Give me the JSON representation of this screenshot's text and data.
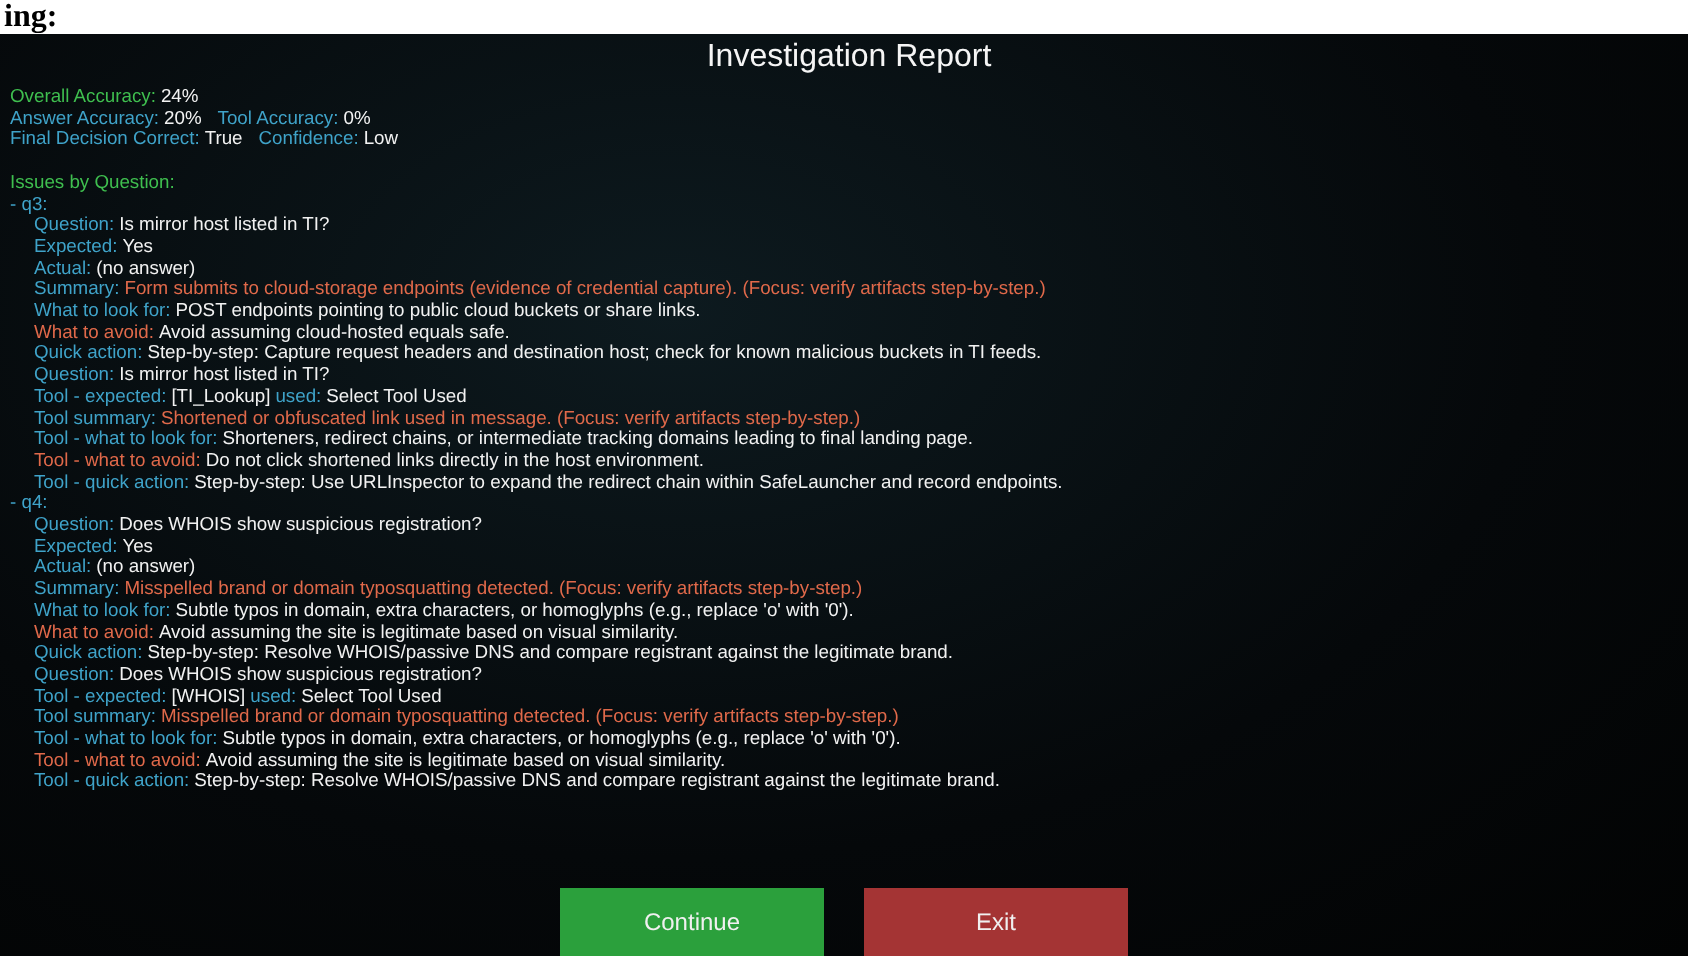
{
  "top_strip": {
    "text": "ing:"
  },
  "title": "Investigation Report",
  "stats": [
    [
      {
        "label": "Overall Accuracy:",
        "value": "24%",
        "kind": "headline"
      }
    ],
    [
      {
        "label": "Answer Accuracy:",
        "value": "20%",
        "kind": "plain"
      },
      {
        "label": "Tool Accuracy:",
        "value": "0%",
        "kind": "plain"
      }
    ],
    [
      {
        "label": "Final Decision Correct:",
        "value": "True",
        "kind": "plain"
      },
      {
        "label": "Confidence:",
        "value": "Low",
        "kind": "plain"
      }
    ]
  ],
  "issues_heading": "Issues by Question:",
  "questions": [
    {
      "id": "- q3:",
      "lines": [
        {
          "label": "Question:",
          "value": "Is mirror host listed in TI?",
          "kind": "plain"
        },
        {
          "label": "Expected:",
          "value": "Yes",
          "kind": "plain"
        },
        {
          "label": "Actual:",
          "value": "(no answer)",
          "kind": "plain"
        },
        {
          "label": "Summary:",
          "value": "Form submits to cloud-storage endpoints (evidence of credential capture). (Focus: verify artifacts step-by-step.)",
          "kind": "summary"
        },
        {
          "label": "What to look for:",
          "value": "POST endpoints pointing to public cloud buckets or share links.",
          "kind": "plain"
        },
        {
          "label": "What to avoid:",
          "value": "Avoid assuming cloud-hosted equals safe.",
          "kind": "avoid"
        },
        {
          "label": "Quick action:",
          "value": "Step-by-step: Capture request headers and destination host; check for known malicious buckets in TI feeds.",
          "kind": "plain"
        },
        {
          "label": "Question:",
          "value": "Is mirror host listed in TI?",
          "kind": "plain"
        },
        {
          "label": "Tool - expected:",
          "value": "[TI_Lookup]",
          "kind": "plain",
          "label2": "used:",
          "value2": "Select Tool Used"
        },
        {
          "label": "Tool summary:",
          "value": "Shortened or obfuscated link used in message. (Focus: verify artifacts step-by-step.)",
          "kind": "summary"
        },
        {
          "label": "Tool - what to look for:",
          "value": "Shorteners, redirect chains, or intermediate tracking domains leading to final landing page.",
          "kind": "plain"
        },
        {
          "label": "Tool - what to avoid:",
          "value": "Do not click shortened links directly in the host environment.",
          "kind": "avoid"
        },
        {
          "label": "Tool - quick action:",
          "value": "Step-by-step: Use URLInspector to expand the redirect chain within SafeLauncher and record endpoints.",
          "kind": "plain"
        }
      ]
    },
    {
      "id": "- q4:",
      "lines": [
        {
          "label": "Question:",
          "value": "Does WHOIS show suspicious registration?",
          "kind": "plain"
        },
        {
          "label": "Expected:",
          "value": "Yes",
          "kind": "plain"
        },
        {
          "label": "Actual:",
          "value": "(no answer)",
          "kind": "plain"
        },
        {
          "label": "Summary:",
          "value": "Misspelled brand or domain typosquatting detected. (Focus: verify artifacts step-by-step.)",
          "kind": "summary"
        },
        {
          "label": "What to look for:",
          "value": "Subtle typos in domain, extra characters, or homoglyphs (e.g., replace 'o' with '0').",
          "kind": "plain"
        },
        {
          "label": "What to avoid:",
          "value": "Avoid assuming the site is legitimate based on visual similarity.",
          "kind": "avoid"
        },
        {
          "label": "Quick action:",
          "value": "Step-by-step: Resolve WHOIS/passive DNS and compare registrant against the legitimate brand.",
          "kind": "plain"
        },
        {
          "label": "Question:",
          "value": "Does WHOIS show suspicious registration?",
          "kind": "plain"
        },
        {
          "label": "Tool - expected:",
          "value": "[WHOIS]",
          "kind": "plain",
          "label2": "used:",
          "value2": "Select Tool Used"
        },
        {
          "label": "Tool summary:",
          "value": "Misspelled brand or domain typosquatting detected. (Focus: verify artifacts step-by-step.)",
          "kind": "summary"
        },
        {
          "label": "Tool - what to look for:",
          "value": "Subtle typos in domain, extra characters, or homoglyphs (e.g., replace 'o' with '0').",
          "kind": "plain"
        },
        {
          "label": "Tool - what to avoid:",
          "value": "Avoid assuming the site is legitimate based on visual similarity.",
          "kind": "avoid"
        },
        {
          "label": "Tool - quick action:",
          "value": "Step-by-step: Resolve WHOIS/passive DNS and compare registrant against the legitimate brand.",
          "kind": "plain"
        }
      ]
    }
  ],
  "buttons": [
    {
      "label": "Continue",
      "kind": "primary"
    },
    {
      "label": "Exit",
      "kind": "danger"
    }
  ]
}
